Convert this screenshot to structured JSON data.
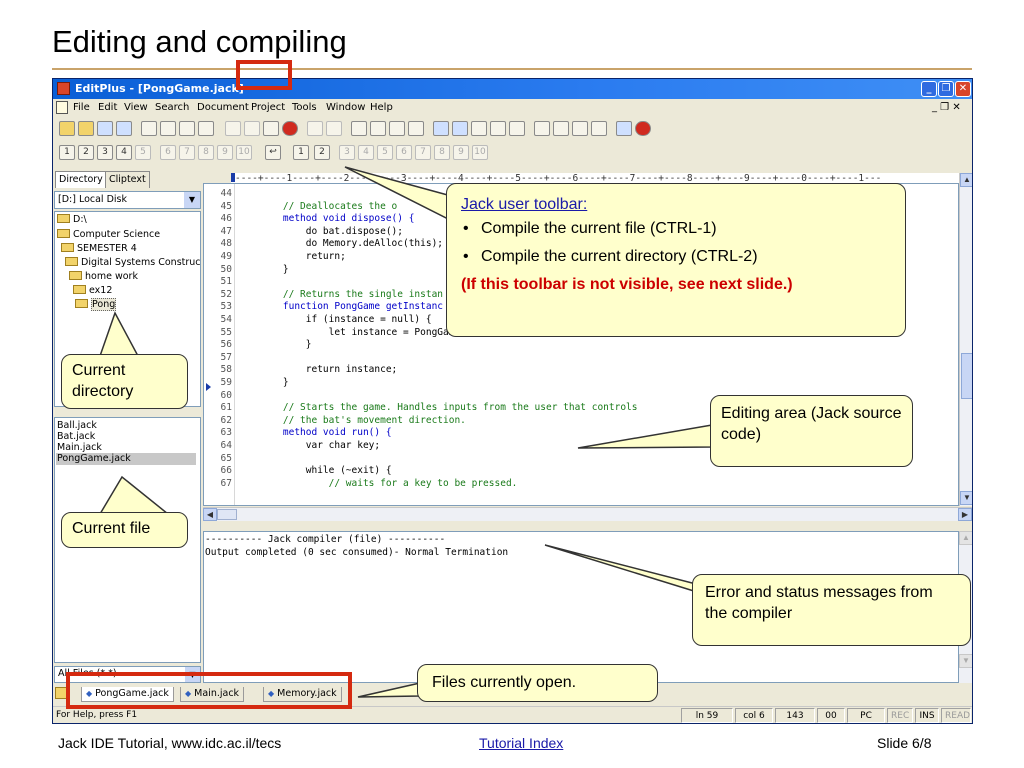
{
  "slide": {
    "title": "Editing and compiling",
    "footer_left": "Jack IDE  Tutorial, www.idc.ac.il/tecs",
    "footer_link": "Tutorial Index",
    "footer_right": "Slide 6/8"
  },
  "window": {
    "title": "EditPlus - [PongGame.jack]",
    "min_label": "_",
    "max_label": "❐",
    "close_label": "✕",
    "mdi_controls": "_ ❐ ✕"
  },
  "menu": {
    "items": [
      "File",
      "Edit",
      "View",
      "Search",
      "Document",
      "Project",
      "Tools",
      "Window",
      "Help"
    ]
  },
  "toolbar2": {
    "numbered_buttons": [
      "1",
      "2",
      "3",
      "4",
      "5",
      "6",
      "7",
      "8",
      "9",
      "10"
    ],
    "jack_buttons": [
      "1",
      "2"
    ],
    "user_tool_buttons": [
      "3",
      "4",
      "5",
      "6",
      "7",
      "8",
      "9",
      "10"
    ]
  },
  "left_panel": {
    "tabs": [
      "Directory",
      "Cliptext"
    ],
    "drive": "[D:] Local Disk",
    "tree": [
      "D:\\",
      "Computer Science",
      "SEMESTER 4",
      "Digital Systems Construction",
      "home work",
      "ex12",
      "Pong"
    ],
    "files": [
      "Ball.jack",
      "Bat.jack",
      "Main.jack",
      "PongGame.jack"
    ],
    "filter": "All Files (*.*)"
  },
  "editor": {
    "ruler": "----+----1----+----2----+----3----+----4----+----5----+----6----+----7----+----8----+----9----+----0----+----1---",
    "lines": [
      {
        "n": "44",
        "code": ""
      },
      {
        "n": "45",
        "code": "    // Deallocates the o"
      },
      {
        "n": "46",
        "code": "    method void dispose() {"
      },
      {
        "n": "47",
        "code": "        do bat.dispose();"
      },
      {
        "n": "48",
        "code": "        do Memory.deAlloc(this);"
      },
      {
        "n": "49",
        "code": "        return;"
      },
      {
        "n": "50",
        "code": "    }"
      },
      {
        "n": "51",
        "code": ""
      },
      {
        "n": "52",
        "code": "    // Returns the single instan"
      },
      {
        "n": "53",
        "code": "    function PongGame getInstanc"
      },
      {
        "n": "54",
        "code": "        if (instance = null) {"
      },
      {
        "n": "55",
        "code": "            let instance = PongGame.new();"
      },
      {
        "n": "56",
        "code": "        }"
      },
      {
        "n": "57",
        "code": ""
      },
      {
        "n": "58",
        "code": "        return instance;"
      },
      {
        "n": "59",
        "code": "    }"
      },
      {
        "n": "60",
        "code": ""
      },
      {
        "n": "61",
        "code": "    // Starts the game. Handles inputs from the user that controls"
      },
      {
        "n": "62",
        "code": "    // the bat's movement direction."
      },
      {
        "n": "63",
        "code": "    method void run() {"
      },
      {
        "n": "64",
        "code": "        var char key;"
      },
      {
        "n": "65",
        "code": ""
      },
      {
        "n": "66",
        "code": "        while (~exit) {"
      },
      {
        "n": "67",
        "code": "            // waits for a key to be pressed."
      }
    ]
  },
  "output": {
    "lines": [
      "---------- Jack compiler (file) ----------",
      "Output completed (0 sec consumed)- Normal Termination"
    ]
  },
  "open_tabs": [
    "PongGame.jack",
    "Main.jack",
    "Memory.jack"
  ],
  "status": {
    "help": "For Help, press F1",
    "ln": "ln 59",
    "col": "col 6",
    "num": "143",
    "code": "00",
    "pc": "PC",
    "rec": "REC",
    "ins": "INS",
    "read": "READ"
  },
  "callouts": {
    "jack_title": "Jack user toolbar:",
    "jack_items": [
      "Compile the current file (CTRL-1)",
      "Compile the current directory (CTRL-2)"
    ],
    "jack_note": "(If this toolbar is not visible, see next slide.)",
    "current_directory": "Current directory",
    "current_file": "Current file",
    "editing_area": "Editing area (Jack source code)",
    "errors": "Error and status messages from the compiler",
    "open_files": "Files currently open."
  }
}
